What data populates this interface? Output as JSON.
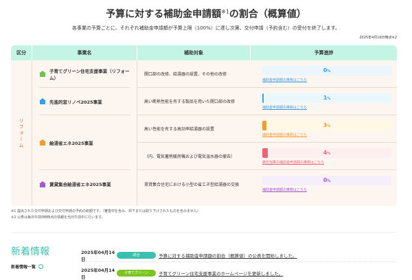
{
  "title": {
    "main": "予算に対する補助金申請額",
    "sup": "※1",
    "rest": "の割合（概算値）"
  },
  "subtitle": "各事業の予算ごとに、それぞれ補助金申請額が予算上限（100%）に達し次第、交付申請（予約含む）の受付を終了します。",
  "as_of": "2025年4月16日時点※2",
  "table": {
    "headers": [
      "区分",
      "事業名",
      "補助対象",
      "予算進捗"
    ],
    "category": "リフォーム",
    "projects": [
      {
        "name": "子育てグリーン住宅支援事業（リフォーム）",
        "icon": "house-icon",
        "color": "#6cc24a"
      },
      {
        "name": "先進的窓リノベ2025事業",
        "icon": "house-icon",
        "color": "#3a9ee4"
      },
      {
        "name": "給湯省エネ2025事業",
        "icon": "house-icon",
        "color": "#f39a2b"
      },
      {
        "name": "賃貸集合給湯省エネ2025事業",
        "icon": "house-icon",
        "color": "#a05ad1"
      }
    ],
    "rows": [
      {
        "target": "開口部の改修、給湯器の設置、その他の改修",
        "percent": 0,
        "unit": "%",
        "link": "補助金申請額の推移はこちら",
        "color": "#3a9ee4",
        "bg": "#eaf5fd"
      },
      {
        "target": "高い断熱性能を有する製品を用いた開口部の改修",
        "percent": 1,
        "unit": "%",
        "link": "補助金申請額の推移はこちら",
        "color": "#3a9ee4",
        "bg": "#eaf7fd"
      },
      {
        "target": "高い性能を有する高効率給湯器の設置",
        "percent": 3,
        "unit": "%",
        "link": "補助金申請額の推移はこちら",
        "color": "#f39a2b",
        "bg": "#fff8e4"
      },
      {
        "target": "（内、電気蓄熱暖房機および電気温水器の撤去）",
        "percent": 4,
        "unit": "%",
        "link": "撤去加算の補助金申請額の推移はこちら",
        "color": "#f0607a",
        "bg": "#fdeff0"
      },
      {
        "target": "賃貸集合住宅における小型の省エネ型給湯器の交換",
        "percent": 0,
        "unit": "%",
        "link": "補助金申請額の推移はこちら",
        "color": "#a05ad1",
        "bg": "#f5effb"
      }
    ]
  },
  "footnotes": [
    "※1 提出された交付申請および交付申請の予約の総額です。（審査中を含み、却下または取り下げされたものを含みません）",
    "※2 公表は毎日午前0時時点の情報を当日午前中に行います。"
  ],
  "news": {
    "heading": "新着情報",
    "list_link": "新着情報一覧",
    "items": [
      {
        "date": "2025年04月14日",
        "badge": "総合",
        "badge_color": "#3bbfae",
        "text": "予算に対する補助金申請額の割合（概算値）の公表を開始しました。"
      },
      {
        "date": "2025年04月14日",
        "badge": "子育てグリーン",
        "badge_color": "#7ac51f",
        "text": "子育てグリーン住宅支援事業のホームページを更新しました。"
      }
    ]
  }
}
